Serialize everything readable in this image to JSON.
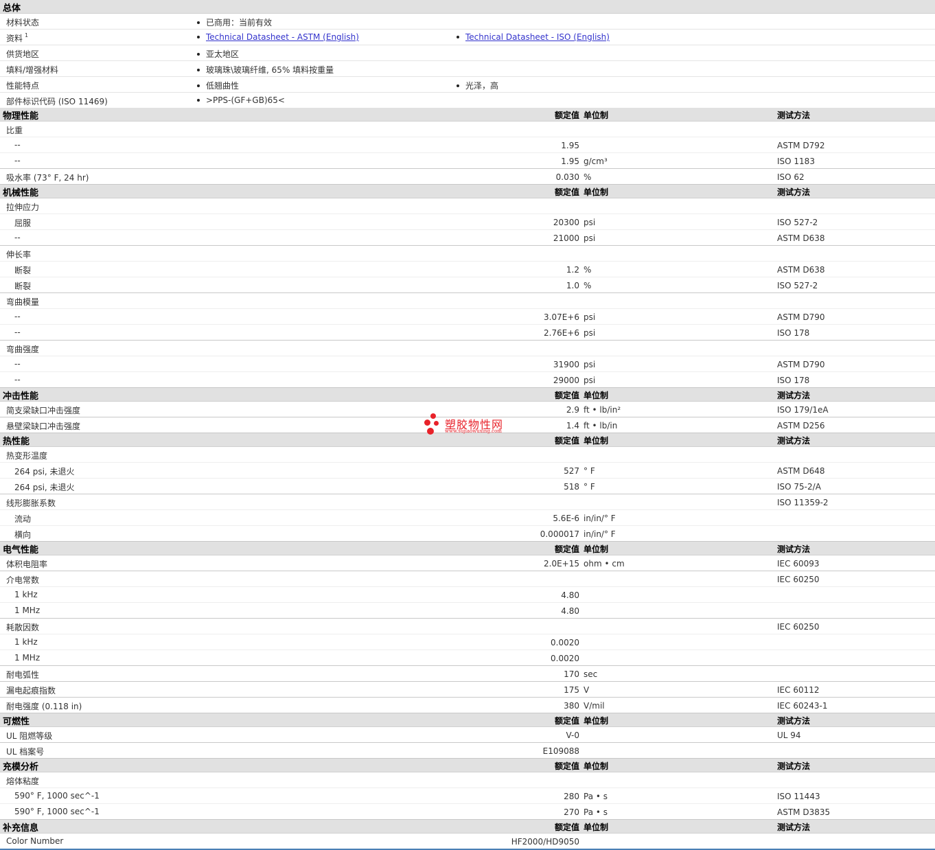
{
  "general": {
    "title": "总体",
    "rows": [
      {
        "label": "材料状态",
        "values": [
          "已商用：当前有效"
        ]
      },
      {
        "label": "资料",
        "footnote": "1",
        "links": [
          "Technical Datasheet - ASTM (English)",
          "Technical Datasheet - ISO (English)"
        ]
      },
      {
        "label": "供货地区",
        "values": [
          "亚太地区"
        ]
      },
      {
        "label": "填料/增强材料",
        "values": [
          "玻璃珠\\玻璃纤维, 65% 填料按重量"
        ]
      },
      {
        "label": "性能特点",
        "values": [
          "低翘曲性",
          "光泽，高"
        ]
      },
      {
        "label": "部件标识代码",
        "cond": "(ISO 11469)",
        "values": [
          ">PPS-(GF+GB)65<"
        ]
      }
    ]
  },
  "columns": {
    "value": "额定值",
    "unit": "单位制",
    "method": "测试方法"
  },
  "sections": [
    {
      "title": "物理性能",
      "rows": [
        {
          "label": "比重",
          "sub": false
        },
        {
          "label": "--",
          "sub": true,
          "value": "1.95",
          "unit": "",
          "method": "ASTM D792"
        },
        {
          "label": "--",
          "sub": true,
          "value": "1.95",
          "unit": "g/cm³",
          "method": "ISO 1183",
          "end": true
        },
        {
          "label": "吸水率",
          "cond": "(73°  F, 24 hr)",
          "sub": false,
          "value": "0.030",
          "unit": "%",
          "method": "ISO 62",
          "end": true
        }
      ]
    },
    {
      "title": "机械性能",
      "rows": [
        {
          "label": "拉伸应力",
          "sub": false
        },
        {
          "label": "屈服",
          "sub": true,
          "value": "20300",
          "unit": "psi",
          "method": "ISO 527-2"
        },
        {
          "label": "--",
          "sub": true,
          "value": "21000",
          "unit": "psi",
          "method": "ASTM D638",
          "end": true
        },
        {
          "label": "伸长率",
          "sub": false
        },
        {
          "label": "断裂",
          "sub": true,
          "value": "1.2",
          "unit": "%",
          "method": "ASTM D638"
        },
        {
          "label": "断裂",
          "sub": true,
          "value": "1.0",
          "unit": "%",
          "method": "ISO 527-2",
          "end": true
        },
        {
          "label": "弯曲模量",
          "sub": false
        },
        {
          "label": "--",
          "sub": true,
          "value": "3.07E+6",
          "unit": "psi",
          "method": "ASTM D790"
        },
        {
          "label": "--",
          "sub": true,
          "value": "2.76E+6",
          "unit": "psi",
          "method": "ISO 178",
          "end": true
        },
        {
          "label": "弯曲强度",
          "sub": false
        },
        {
          "label": "--",
          "sub": true,
          "value": "31900",
          "unit": "psi",
          "method": "ASTM D790"
        },
        {
          "label": "--",
          "sub": true,
          "value": "29000",
          "unit": "psi",
          "method": "ISO 178",
          "end": true
        }
      ]
    },
    {
      "title": "冲击性能",
      "rows": [
        {
          "label": "简支梁缺口冲击强度",
          "sub": false,
          "value": "2.9",
          "unit": "ft • lb/in²",
          "method": "ISO 179/1eA",
          "end": true
        },
        {
          "label": "悬壁梁缺口冲击强度",
          "sub": false,
          "value": "1.4",
          "unit": "ft • lb/in",
          "method": "ASTM D256",
          "end": true
        }
      ]
    },
    {
      "title": "热性能",
      "rows": [
        {
          "label": "热变形温度",
          "sub": false
        },
        {
          "label": "264 psi, 未退火",
          "sub": true,
          "value": "527",
          "unit": "°  F",
          "method": "ASTM D648"
        },
        {
          "label": "264 psi, 未退火",
          "sub": true,
          "value": "518",
          "unit": "°  F",
          "method": "ISO 75-2/A",
          "end": true
        },
        {
          "label": "线形膨胀系数",
          "sub": false,
          "method": "ISO 11359-2"
        },
        {
          "label": "流动",
          "sub": true,
          "value": "5.6E-6",
          "unit": "in/in/°  F"
        },
        {
          "label": "横向",
          "sub": true,
          "value": "0.000017",
          "unit": "in/in/°  F",
          "end": true
        }
      ]
    },
    {
      "title": "电气性能",
      "rows": [
        {
          "label": "体积电阻率",
          "sub": false,
          "value": "2.0E+15",
          "unit": "ohm • cm",
          "method": "IEC 60093",
          "end": true
        },
        {
          "label": "介电常数",
          "sub": false,
          "method": "IEC 60250"
        },
        {
          "label": "1 kHz",
          "sub": true,
          "value": "4.80"
        },
        {
          "label": "1 MHz",
          "sub": true,
          "value": "4.80",
          "end": true
        },
        {
          "label": "耗散因数",
          "sub": false,
          "method": "IEC 60250"
        },
        {
          "label": "1 kHz",
          "sub": true,
          "value": "0.0020"
        },
        {
          "label": "1 MHz",
          "sub": true,
          "value": "0.0020",
          "end": true
        },
        {
          "label": "耐电弧性",
          "sub": false,
          "value": "170",
          "unit": "sec",
          "end": true
        },
        {
          "label": "漏电起痕指数",
          "sub": false,
          "value": "175",
          "unit": "V",
          "method": "IEC 60112",
          "end": true
        },
        {
          "label": "耐电强度",
          "cond": "(0.118 in)",
          "sub": false,
          "value": "380",
          "unit": "V/mil",
          "method": "IEC 60243-1",
          "end": true
        }
      ]
    },
    {
      "title": "可燃性",
      "rows": [
        {
          "label": "UL 阻燃等级",
          "sub": false,
          "value": "V-0",
          "method": "UL 94",
          "end": true
        },
        {
          "label": "UL 档案号",
          "sub": false,
          "value": "E109088",
          "end": true
        }
      ]
    },
    {
      "title": "充模分析",
      "rows": [
        {
          "label": "熔体粘度",
          "sub": false
        },
        {
          "label": "590°  F, 1000 sec^-1",
          "sub": true,
          "value": "280",
          "unit": "Pa • s",
          "method": "ISO 11443"
        },
        {
          "label": "590°  F, 1000 sec^-1",
          "sub": true,
          "value": "270",
          "unit": "Pa • s",
          "method": "ASTM D3835",
          "end": true
        }
      ]
    },
    {
      "title": "补充信息",
      "rows": [
        {
          "label": "Color Number",
          "sub": false,
          "value": "HF2000/HD9050",
          "end": true
        }
      ]
    }
  ],
  "watermark": {
    "title": "塑胶物性网",
    "url": "www.sujiaowuxing.com",
    "color": "#e8222a"
  }
}
